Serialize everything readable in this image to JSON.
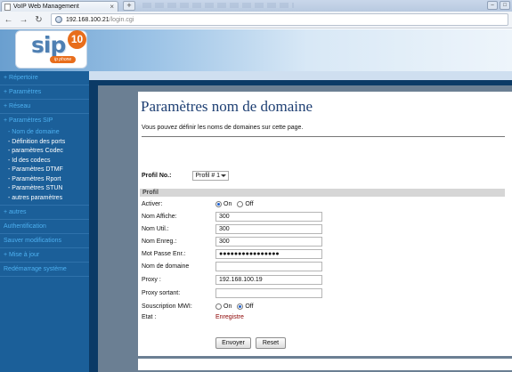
{
  "browser": {
    "tab_title": "VoIP Web Management",
    "new_tab": "+",
    "address_host": "192.168.100.21",
    "address_path": "/login.cgi",
    "back_icon": "back-arrow-icon",
    "forward_icon": "forward-arrow-icon",
    "reload_icon": "reload-icon"
  },
  "logo": {
    "text": "sip",
    "badge": "10",
    "sub": "ip phone"
  },
  "sidebar": {
    "items_top": [
      {
        "label": "+ Répertoire"
      },
      {
        "label": "+ Paramètres"
      },
      {
        "label": "+ Réseau"
      },
      {
        "label": "+ Paramètres SIP"
      }
    ],
    "sub_items": [
      {
        "label": "- Nom de domaine"
      },
      {
        "label": "- Définition des ports"
      },
      {
        "label": "- paramètres Codec"
      },
      {
        "label": "- Id des codecs"
      },
      {
        "label": "- Paramètres DTMF"
      },
      {
        "label": "- Paramètres Rport"
      },
      {
        "label": "- Paramètres STUN"
      },
      {
        "label": "- autres paramètres"
      }
    ],
    "items_bottom": [
      {
        "label": "+ autres"
      },
      {
        "label": "Authentification"
      },
      {
        "label": "Sauver modifications"
      },
      {
        "label": "+ Mise à jour"
      },
      {
        "label": "Redémarrage système"
      }
    ]
  },
  "content": {
    "title": "Paramètres nom de domaine",
    "intro": "Vous pouvez définir les noms de domaines sur cette page.",
    "profile_label": "Profil No.:",
    "profile_value": "Profil # 1",
    "section_title": "Profil",
    "fields": {
      "activer": {
        "label": "Activer:",
        "on": "On",
        "off": "Off",
        "selected": "On"
      },
      "nom_affiche": {
        "label": "Nom Affiche:",
        "value": "300"
      },
      "nom_util": {
        "label": "Nom Util.:",
        "value": "300"
      },
      "nom_enreg": {
        "label": "Nom Enreg.:",
        "value": "300"
      },
      "mot_passe": {
        "label": "Mot Passe Enr.:",
        "value": "●●●●●●●●●●●●●●●●"
      },
      "nom_domaine": {
        "label": "Nom de domaine",
        "value": ""
      },
      "proxy": {
        "label": "Proxy :",
        "value": "192.168.100.19"
      },
      "proxy_sortant": {
        "label": "Proxy sortant:",
        "value": ""
      },
      "souscription": {
        "label": "Souscription MWI:",
        "on": "On",
        "off": "Off",
        "selected": "Off"
      },
      "etat": {
        "label": "Etat :",
        "value": "Enregistre"
      }
    },
    "submit_label": "Envoyer",
    "reset_label": "Reset"
  },
  "colors": {
    "sidebar_bg": "#1b5f99",
    "sidebar_link": "#4db0f0",
    "title_color": "#1e3f73",
    "status_color": "#8b0000"
  }
}
